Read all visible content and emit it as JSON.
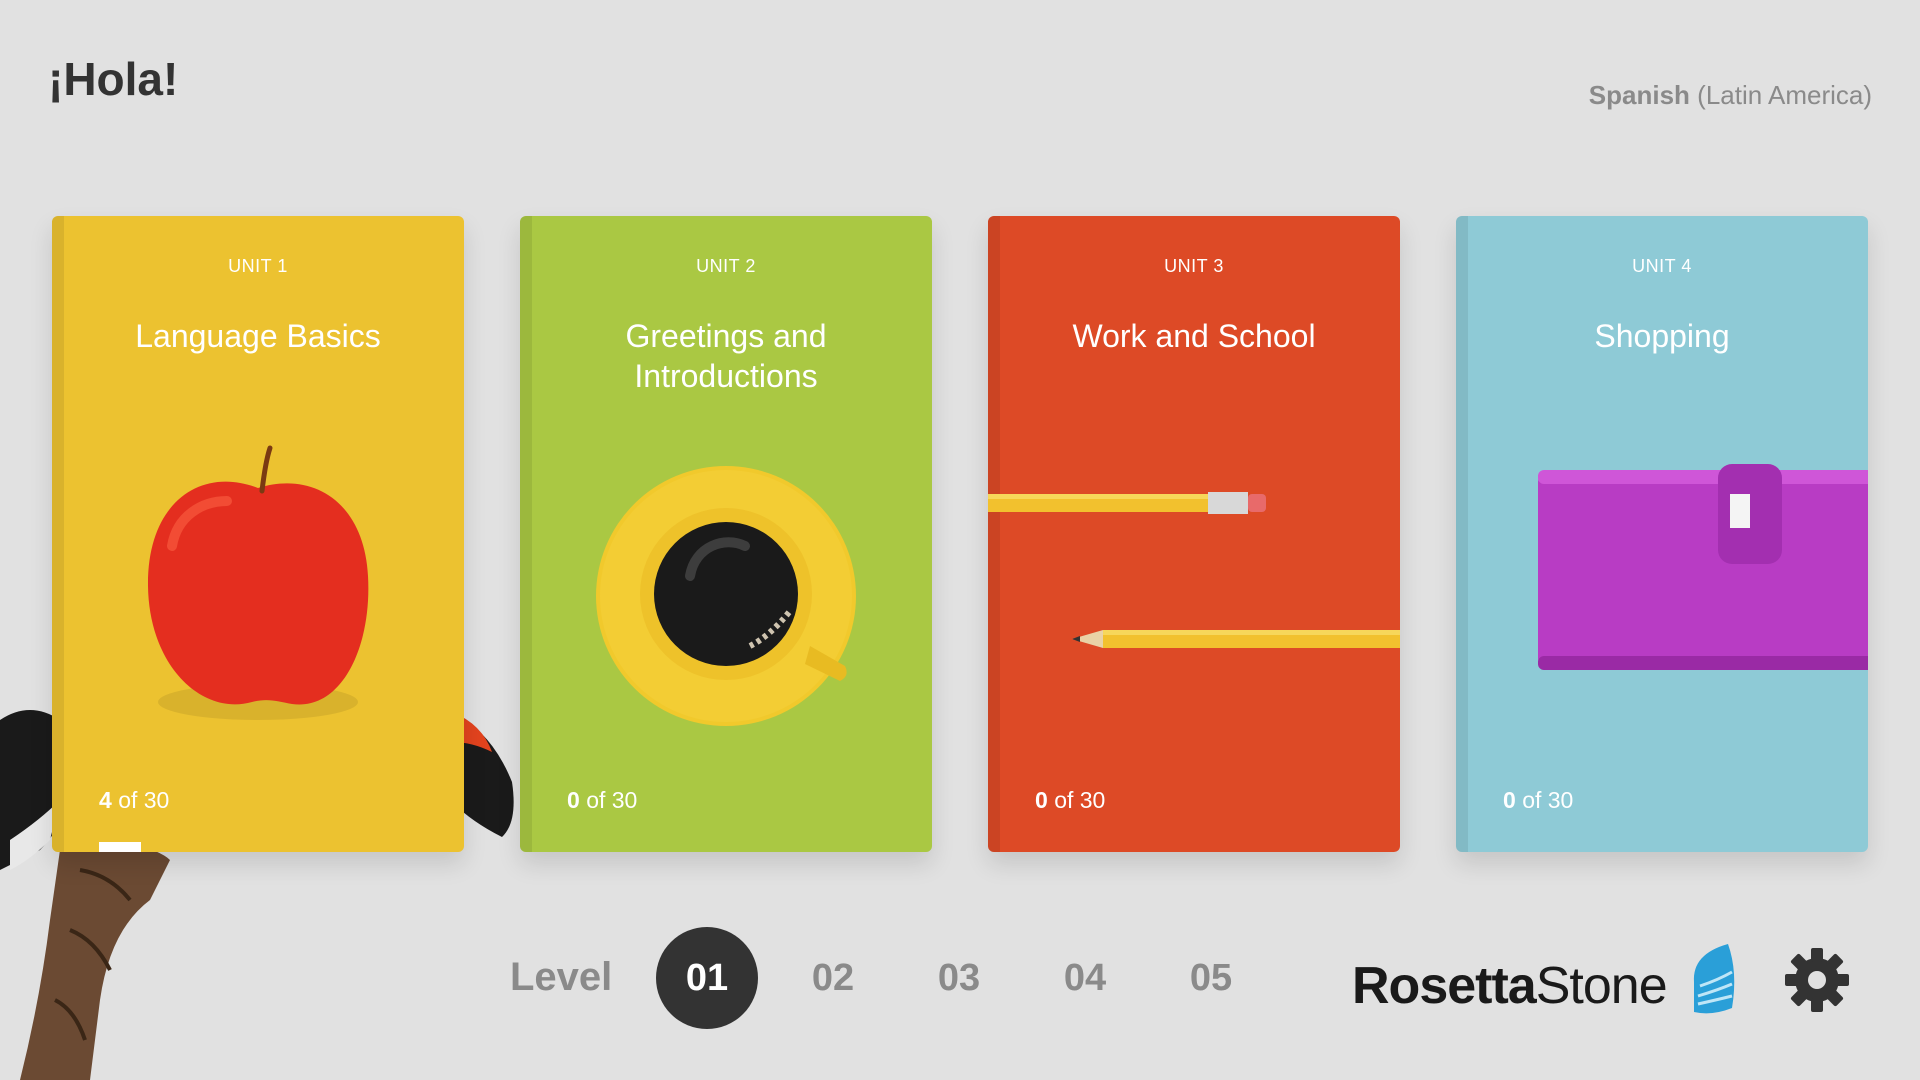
{
  "header": {
    "greeting": "¡Hola!",
    "language_name": "Spanish",
    "language_region": "(Latin America)"
  },
  "units": [
    {
      "unit_label": "UNIT 1",
      "title": "Language Basics",
      "completed": "4",
      "progress_suffix": "of 30",
      "color": "#ecc230",
      "image": "apple-icon"
    },
    {
      "unit_label": "UNIT 2",
      "title": "Greetings and Introductions",
      "completed": "0",
      "progress_suffix": "of 30",
      "color": "#aac843",
      "image": "coffee-cup-icon"
    },
    {
      "unit_label": "UNIT 3",
      "title": "Work and School",
      "completed": "0",
      "progress_suffix": "of 30",
      "color": "#dd4a26",
      "image": "pencils-icon"
    },
    {
      "unit_label": "UNIT 4",
      "title": "Shopping",
      "completed": "0",
      "progress_suffix": "of 30",
      "color": "#8ecad6",
      "image": "wallet-icon"
    }
  ],
  "levels": {
    "label": "Level",
    "items": [
      "01",
      "02",
      "03",
      "04",
      "05"
    ],
    "selected": "01"
  },
  "brand": {
    "name_part1": "Rosetta",
    "name_part2": "Stone"
  },
  "icons": [
    "toucan-icon",
    "rosetta-stone-logo-icon",
    "gear-icon"
  ]
}
